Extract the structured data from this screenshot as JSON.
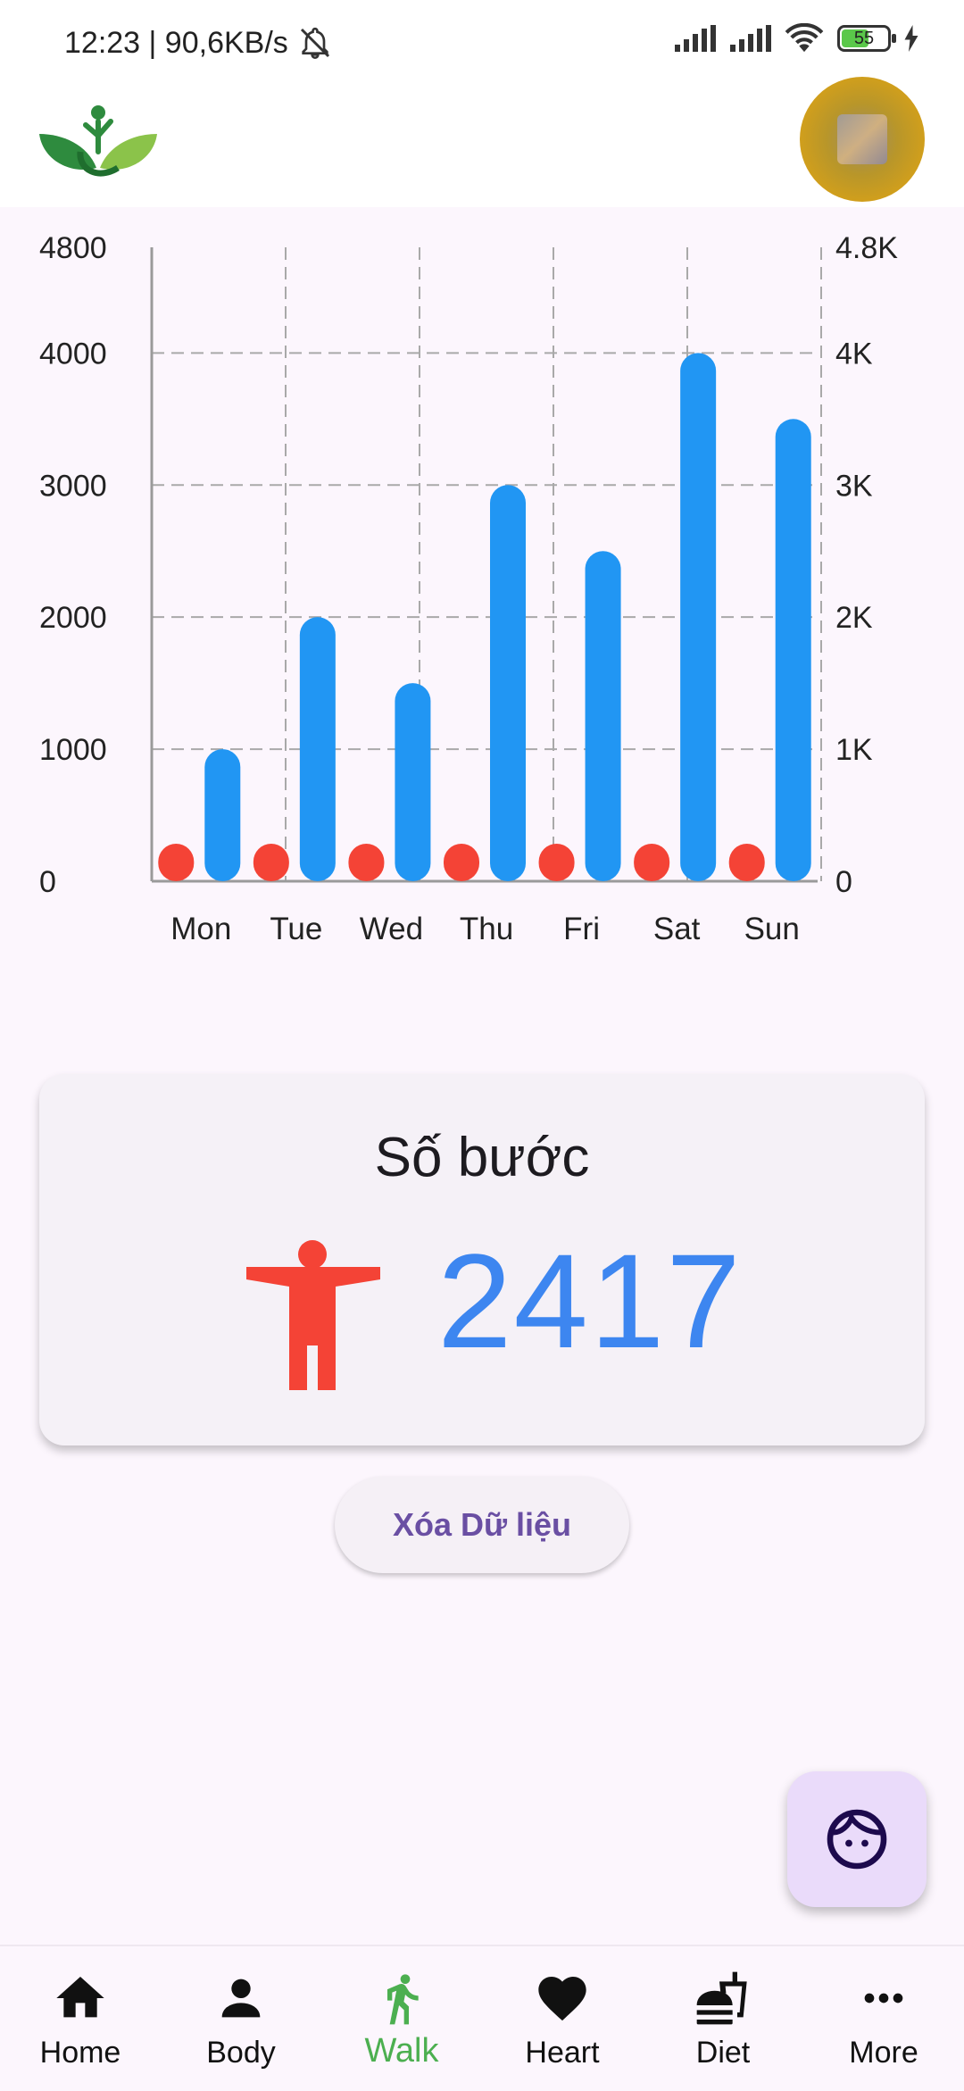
{
  "status_bar": {
    "time_speed": "12:23 | 90,6KB/s",
    "battery": "55"
  },
  "chart_data": {
    "type": "bar",
    "categories": [
      "Mon",
      "Tue",
      "Wed",
      "Thu",
      "Fri",
      "Sat",
      "Sun"
    ],
    "series": [
      {
        "values": [
          0,
          0,
          0,
          0,
          0,
          0,
          0
        ],
        "color": "#f44336"
      },
      {
        "values": [
          1000,
          2000,
          1500,
          3000,
          2500,
          4000,
          3500
        ],
        "color": "#2196f3"
      }
    ],
    "left_ticks": [
      "0",
      "1000",
      "2000",
      "3000",
      "4000",
      "4800"
    ],
    "right_ticks": [
      "0",
      "1K",
      "2K",
      "3K",
      "4K",
      "4.8K"
    ],
    "ylim": [
      0,
      4800
    ],
    "grid": true
  },
  "card": {
    "title": "Số bước",
    "steps": "2417"
  },
  "clear_button": {
    "label": "Xóa Dữ liệu"
  },
  "nav": [
    {
      "label": "Home",
      "icon": "home-icon"
    },
    {
      "label": "Body",
      "icon": "person-icon"
    },
    {
      "label": "Walk",
      "icon": "walk-icon",
      "active": true
    },
    {
      "label": "Heart",
      "icon": "heart-icon"
    },
    {
      "label": "Diet",
      "icon": "fastfood-icon"
    },
    {
      "label": "More",
      "icon": "more-icon"
    }
  ],
  "colors": {
    "accent_green": "#4caf50",
    "bar_blue": "#2196f3",
    "dot_red": "#f44336",
    "steps_blue": "#3d86f0",
    "button_text": "#6a4fa3"
  }
}
